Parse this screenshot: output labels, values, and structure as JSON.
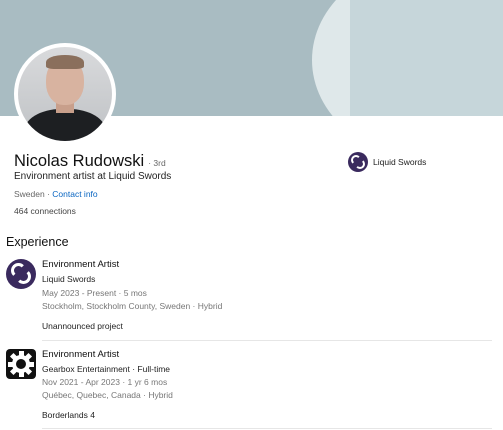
{
  "profile": {
    "name": "Nicolas Rudowski",
    "degree": "· 3rd",
    "headline": "Environment artist at Liquid Swords",
    "location": "Sweden · ",
    "contact_info": "Contact info",
    "connections": "464 connections",
    "current_company": "Liquid Swords"
  },
  "experience": {
    "section_title": "Experience",
    "items": [
      {
        "logo": "liquid-swords-logo",
        "title": "Environment Artist",
        "company": "Liquid Swords",
        "dates": "May 2023 - Present · 5 mos",
        "location": "Stockholm, Stockholm County, Sweden · Hybrid",
        "description": "Unannounced project"
      },
      {
        "logo": "gearbox-logo",
        "title": "Environment Artist",
        "company": "Gearbox Entertainment · Full-time",
        "dates": "Nov 2021 - Apr 2023 · 1 yr 6 mos",
        "location": "Québec, Quebec, Canada · Hybrid",
        "description": "Borderlands 4"
      }
    ]
  },
  "colors": {
    "banner": "#a9bcc2",
    "link": "#0a66c2",
    "liquid_swords_brand": "#3a2a5e"
  }
}
